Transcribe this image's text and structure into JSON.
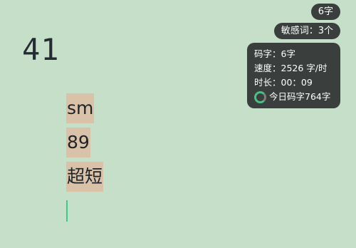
{
  "counter": "41",
  "badges": {
    "char_count": "6字",
    "sensitive": "敏感词：3个"
  },
  "stats": {
    "typed": "码字：6字",
    "speed": "速度：2526 字/时",
    "duration": "时长：00：09",
    "today": "今日码字764字"
  },
  "words": [
    "sm",
    "89",
    "超短"
  ],
  "icons": {
    "today_progress": "ring-progress-icon"
  },
  "colors": {
    "background": "#c5dfc8",
    "panel": "#3a3f3d",
    "highlight": "#d9c2a7",
    "cursor": "#3ccb86"
  }
}
